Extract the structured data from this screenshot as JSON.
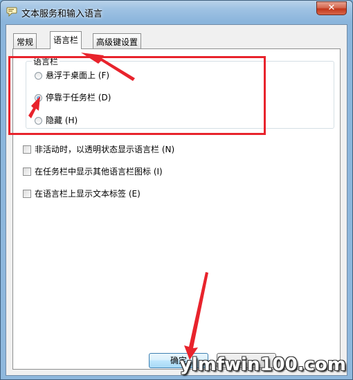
{
  "window": {
    "title": "文本服务和输入语言",
    "close_label": "✕"
  },
  "tabs": [
    {
      "label": "常规",
      "selected": false
    },
    {
      "label": "语言栏",
      "selected": true
    },
    {
      "label": "高级键设置",
      "selected": false
    }
  ],
  "language_bar_group": {
    "label": "语言栏",
    "options": [
      {
        "label": "悬浮于桌面上 (F)",
        "checked": false
      },
      {
        "label": "停靠于任务栏 (D)",
        "checked": true
      },
      {
        "label": "隐藏 (H)",
        "checked": false
      }
    ]
  },
  "checkboxes": [
    {
      "label": "非活动时，以透明状态显示语言栏 (N)",
      "checked": false
    },
    {
      "label": "在任务栏中显示其他语言栏图标 (I)",
      "checked": false
    },
    {
      "label": "在语言栏上显示文本标签 (E)",
      "checked": false
    }
  ],
  "buttons": {
    "ok_label": "确定"
  },
  "annotation_color": "#e8232c",
  "watermark": "ylmfwin100.com"
}
